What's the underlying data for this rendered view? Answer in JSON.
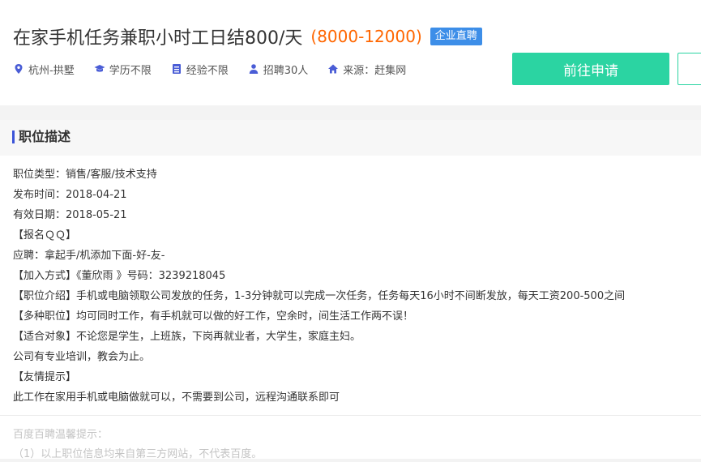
{
  "header": {
    "title": "在家手机任务兼职小时工日结800/天",
    "salary": "(8000-12000)",
    "badge": "企业直聘",
    "apply_label": "前往申请",
    "meta": [
      {
        "icon": "location-pin-icon",
        "text": "杭州-拱墅"
      },
      {
        "icon": "graduation-cap-icon",
        "text": "学历不限"
      },
      {
        "icon": "document-icon",
        "text": "经验不限"
      },
      {
        "icon": "person-icon",
        "text": "招聘30人"
      },
      {
        "icon": "home-icon",
        "text": "来源：赶集网"
      }
    ]
  },
  "description": {
    "section_title": "职位描述",
    "lines": [
      "职位类型：销售/客服/技术支持",
      "发布时间：2018-04-21",
      "有效日期：2018-05-21",
      "【报名ＱＱ】",
      "应聘：拿起手/机添加下面-好-友-",
      "【加入方式】《董欣雨 》号码：3239218045",
      "【职位介绍】手机或电脑领取公司发放的任务，1-3分钟就可以完成一次任务，任务每天16小时不间断发放，每天工资200-500之间",
      "【多种职位】均可同时工作，有手机就可以做的好工作，空余时，间生活工作两不误！",
      "【适合对象】不论您是学生，上班族，下岗再就业者，大学生，家庭主妇。",
      "公司有专业培训，教会为止。",
      "【友情提示】",
      "此工作在家用手机或电脑做就可以，不需要到公司，远程沟通联系即可"
    ],
    "notice_title": "百度百聘温馨提示：",
    "notice_line": "（1）以上职位信息均来自第三方网站，不代表百度。"
  },
  "colors": {
    "accent_green": "#2bd4a2",
    "salary_orange": "#ff6600",
    "badge_blue": "#3d8ee8",
    "section_bar": "#3b54d8",
    "icon_blue": "#4a5dd6"
  }
}
